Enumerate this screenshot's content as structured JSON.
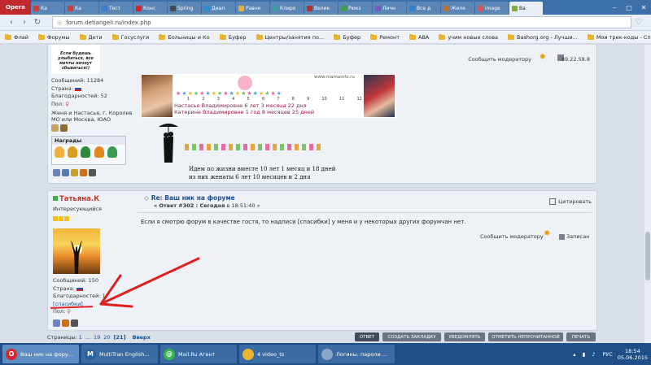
{
  "browser": {
    "menu_label": "Opera",
    "tabs": [
      {
        "label": "Ка",
        "color": "#d33c3c"
      },
      {
        "label": "Ка",
        "color": "#d33c3c"
      },
      {
        "label": "Тест",
        "color": "#3b7dd8"
      },
      {
        "label": "Конс",
        "color": "#e02020"
      },
      {
        "label": "Spring",
        "color": "#4a4a4a"
      },
      {
        "label": "Диал",
        "color": "#2b8fd6"
      },
      {
        "label": "Равно",
        "color": "#e8b030"
      },
      {
        "label": "Клиро",
        "color": "#3aa0a0"
      },
      {
        "label": "Велик",
        "color": "#b03030"
      },
      {
        "label": "Рюкз",
        "color": "#3c9e3c"
      },
      {
        "label": "Личн",
        "color": "#7a5ac0"
      },
      {
        "label": "Все д",
        "color": "#2d7fd3"
      },
      {
        "label": "Жиле",
        "color": "#c07030"
      },
      {
        "label": "image",
        "color": "#e05050"
      },
      {
        "label": "Ва",
        "color": "#7ab03c"
      }
    ],
    "url": "forum.detiangeli.ru/index.php",
    "bookmarks": [
      "Флай",
      "Форумы",
      "Дети",
      "Госуслуги",
      "Больницы и Ко",
      "Буфер",
      "Центры/занятия по...",
      "Буфер",
      "Ремонт",
      "АВА",
      "учим новые слова",
      "Bashorg.org - Лучши...",
      "Мои трек-коды - Сп..."
    ]
  },
  "post1": {
    "avatar_caption": "Если будешь улыбаться, все мечты начнут сбываться!)",
    "messages_label": "Сообщений: 11284",
    "country_label": "Страна:",
    "thanks_label": "Благодарностей: 52",
    "gender_label": "Пол:",
    "location": "Женя и Настасья, г. Королев МО или Москва, ЮАО",
    "awards_title": "Награды",
    "report": "Сообщить модератору",
    "ip": "89.22.58.8",
    "banner": {
      "site": "www.mamainfo.ru",
      "line1": "Настасье Владимировне 6 лет 3 месяца 22 дня",
      "line2": "Катерине Владимировне 1 год 8 месяцев 25 дней",
      "ruler": [
        "1",
        "2",
        "3",
        "4",
        "5",
        "6",
        "7",
        "8",
        "9",
        "10",
        "11",
        "12"
      ]
    },
    "script_line1": "Идем по жизни вместе 10 лет 1 месяц и 18 дней",
    "script_line2": "из них женаты 6 лет 10 месяцев и 2 дня"
  },
  "post2": {
    "username": "Татьяна.К",
    "rank": "Интересующийся",
    "messages_label": "Сообщений: 150",
    "country_label": "Страна:",
    "thanks_label": "Благодарностей: 1",
    "thanks_link": "[спасибки]",
    "gender_label": "Пол:",
    "subject": "Re: Ваш ник на форуме",
    "meta_prefix": "« Ответ #302 : Сегодня",
    "meta_time": "в 18:51:40 »",
    "quote": "Цитировать",
    "body": "Если я смотрю форум в качестве гостя, то надписи [спасибки] у меня и у некоторых других форумчан нет.",
    "report": "Сообщить модератору",
    "logged": "Записан"
  },
  "pager": {
    "label": "Страницы:",
    "first": "1",
    "ellipsis": "...",
    "p19": "19",
    "p20": "20",
    "current": "[21]",
    "up": "Вверх"
  },
  "actions": [
    "ОТВЕТ",
    "СОЗДАТЬ ЗАКЛАДКУ",
    "УВЕДОМЛЯТЬ",
    "ОТМЕТИТЬ НЕПРОЧИТАННОЙ",
    "ПЕЧАТЬ"
  ],
  "taskbar": {
    "tasks": [
      {
        "label": "Ваш ник на фору...",
        "color": "#d8262a",
        "glyph": "O"
      },
      {
        "label": "MultiTran English...",
        "color": "#2a5fa0",
        "glyph": "M"
      },
      {
        "label": "Mail.Ru Агент",
        "color": "#39b54a",
        "glyph": "@"
      },
      {
        "label": "4 video_ts",
        "color": "#e7b533",
        "glyph": ""
      },
      {
        "label": "Логины, пароли ...",
        "color": "#8aa6c6",
        "glyph": ""
      }
    ],
    "lang": "РУС",
    "time": "18:54",
    "date": "05.06.2015"
  }
}
